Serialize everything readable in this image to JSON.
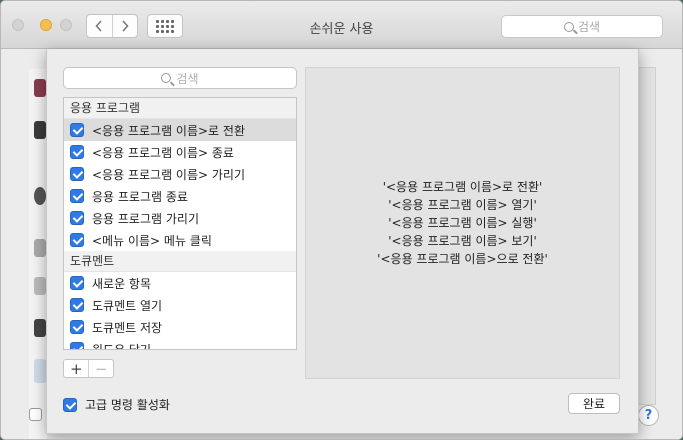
{
  "window": {
    "title": "손쉬운 사용"
  },
  "toolbar": {
    "back_icon": "chevron-left-icon",
    "forward_icon": "chevron-right-icon",
    "show_all_icon": "grid-icon",
    "search_placeholder": "검색"
  },
  "sheet": {
    "search_placeholder": "검색",
    "sections": [
      {
        "title": "응용 프로그램",
        "items": [
          {
            "label": "<응용 프로그램 이름>로 전환",
            "checked": true,
            "selected": true
          },
          {
            "label": "<응용 프로그램 이름> 종료",
            "checked": true
          },
          {
            "label": "<응용 프로그램 이름> 가리기",
            "checked": true
          },
          {
            "label": "응용 프로그램 종료",
            "checked": true
          },
          {
            "label": "응용 프로그램 가리기",
            "checked": true
          },
          {
            "label": "<메뉴 이름> 메뉴 클릭",
            "checked": true
          }
        ]
      },
      {
        "title": "도큐멘트",
        "items": [
          {
            "label": "새로운 항목",
            "checked": true
          },
          {
            "label": "도큐멘트 열기",
            "checked": true
          },
          {
            "label": "도큐멘트 저장",
            "checked": true
          },
          {
            "label": "윈도우 닫기",
            "checked": true
          }
        ]
      }
    ],
    "add_label": "+",
    "remove_label": "−",
    "preview_lines": [
      "'<응용 프로그램 이름>로 전환'",
      "'<응용 프로그램 이름> 열기'",
      "'<응용 프로그램 이름> 실행'",
      "'<응용 프로그램 이름> 보기'",
      "'<응용 프로그램 이름>으로 전환'"
    ],
    "advanced_label": "고급 명령 활성화",
    "advanced_checked": true,
    "done_label": "완료"
  },
  "background": {
    "help_label": "?"
  },
  "colors": {
    "accent": "#2f7ae5",
    "minimize": "#f5bf4f"
  }
}
